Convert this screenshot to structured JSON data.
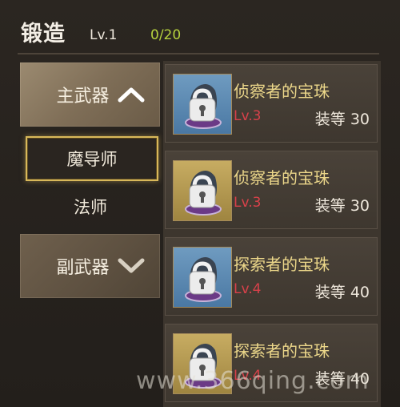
{
  "header": {
    "title": "锻造",
    "level": "Lv.1",
    "count": "0/20"
  },
  "nav": {
    "main_weapon": "主武器",
    "sub_items": [
      "魔导师",
      "法师"
    ],
    "off_weapon": "副武器"
  },
  "items": [
    {
      "name": "侦察者的宝珠",
      "level": "Lv.3",
      "gear_level": "装等 30",
      "icon_bg": "blue"
    },
    {
      "name": "侦察者的宝珠",
      "level": "Lv.3",
      "gear_level": "装等 30",
      "icon_bg": "gold"
    },
    {
      "name": "探索者的宝珠",
      "level": "Lv.4",
      "gear_level": "装等 40",
      "icon_bg": "blue"
    },
    {
      "name": "探索者的宝珠",
      "level": "Lv.4",
      "gear_level": "装等 40",
      "icon_bg": "gold"
    }
  ],
  "watermark": "www.366qing.com",
  "colors": {
    "item_name": "#ecd78a",
    "item_level": "#d9414a",
    "count": "#b6d23e",
    "selected_border": "#d8b85a"
  }
}
